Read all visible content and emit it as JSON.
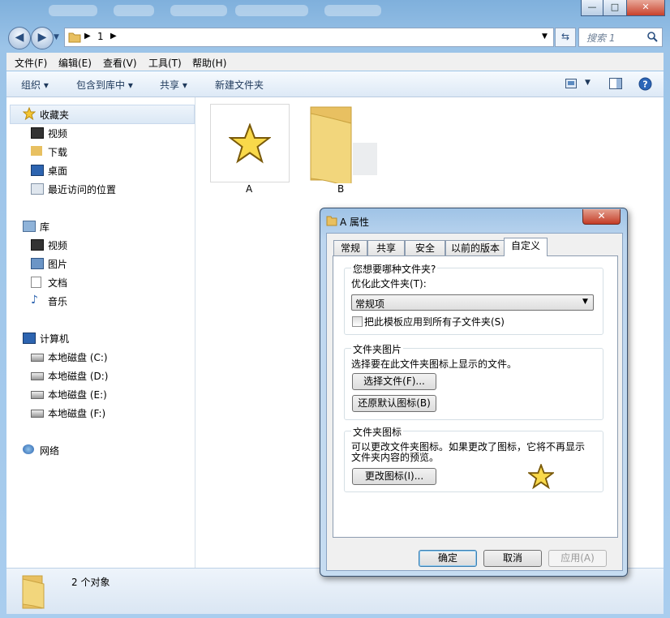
{
  "address": {
    "path_segment": "1"
  },
  "search": {
    "placeholder": "搜索 1"
  },
  "menu": [
    "文件(F)",
    "编辑(E)",
    "查看(V)",
    "工具(T)",
    "帮助(H)"
  ],
  "toolbar": {
    "organize": "组织",
    "include_library": "包含到库中",
    "share": "共享",
    "new_folder": "新建文件夹"
  },
  "nav": {
    "favorites": {
      "title": "收藏夹",
      "items": [
        "视频",
        "下载",
        "桌面",
        "最近访问的位置"
      ]
    },
    "libraries": {
      "title": "库",
      "items": [
        "视频",
        "图片",
        "文档",
        "音乐"
      ]
    },
    "computer": {
      "title": "计算机",
      "items": [
        "本地磁盘 (C:)",
        "本地磁盘 (D:)",
        "本地磁盘 (E:)",
        "本地磁盘 (F:)"
      ]
    },
    "network": {
      "title": "网络"
    }
  },
  "files": [
    {
      "name": "A"
    },
    {
      "name": "B"
    }
  ],
  "status": {
    "count": "2 个对象"
  },
  "dialog": {
    "title": "A 属性",
    "tabs": [
      "常规",
      "共享",
      "安全",
      "以前的版本",
      "自定义"
    ],
    "active_tab": "自定义",
    "group1": {
      "title": "您想要哪种文件夹?",
      "optimize_label": "优化此文件夹(T):",
      "optimize_value": "常规项",
      "apply_sub_label": "把此模板应用到所有子文件夹(S)"
    },
    "group2": {
      "title": "文件夹图片",
      "desc": "选择要在此文件夹图标上显示的文件。",
      "choose_button": "选择文件(F)...",
      "restore_button": "还原默认图标(B)"
    },
    "group3": {
      "title": "文件夹图标",
      "desc_line1": "可以更改文件夹图标。如果更改了图标，它将不再显示",
      "desc_line2": "文件夹内容的预览。",
      "change_button": "更改图标(I)..."
    },
    "ok_button": "确定",
    "cancel_button": "取消",
    "apply_button": "应用(A)"
  }
}
